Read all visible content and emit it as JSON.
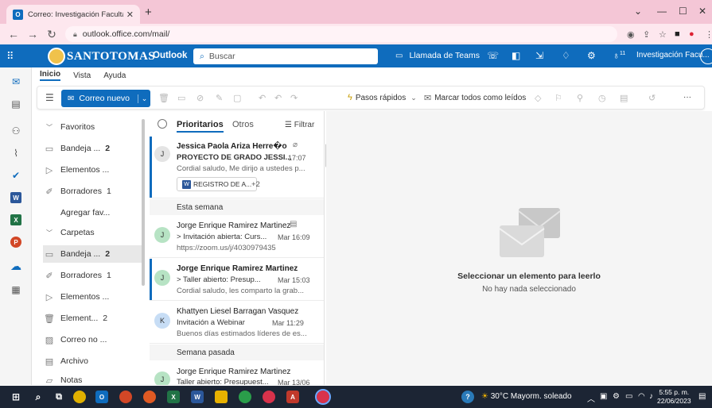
{
  "browser": {
    "tab_title": "Correo: Investigación Facultad de",
    "tab_close": "✕",
    "new_tab": "+",
    "url": "outlook.office.com/mail/",
    "win_min": "—",
    "win_max": "☐",
    "win_close": "✕",
    "win_menu": "⌄"
  },
  "suite": {
    "logo_text": "SANTOTOMAS",
    "app_name": "Outlook",
    "search_placeholder": "Buscar",
    "teams_call": "Llamada de Teams",
    "account": "Investigación Facu...",
    "badge": "11"
  },
  "ribbon_tabs": [
    "Inicio",
    "Vista",
    "Ayuda"
  ],
  "ribbon": {
    "new_mail": "Correo nuevo",
    "quick_steps": "Pasos rápidos",
    "mark_all_read": "Marcar todos como leídos",
    "more": "···"
  },
  "folders": {
    "favorites_label": "Favoritos",
    "fav_items": [
      {
        "label": "Bandeja ...",
        "count": "2"
      },
      {
        "label": "Elementos ...",
        "count": ""
      },
      {
        "label": "Borradores",
        "count": "1"
      }
    ],
    "add_favorite": "Agregar fav...",
    "folders_label": "Carpetas",
    "folder_items": [
      {
        "label": "Bandeja ...",
        "count": "2"
      },
      {
        "label": "Borradores",
        "count": "1"
      },
      {
        "label": "Elementos ...",
        "count": ""
      },
      {
        "label": "Element...",
        "count": "2"
      },
      {
        "label": "Correo no ...",
        "count": ""
      },
      {
        "label": "Archivo",
        "count": ""
      },
      {
        "label": "Notas",
        "count": ""
      }
    ]
  },
  "list": {
    "tab_focused": "Prioritarios",
    "tab_other": "Otros",
    "filter": "Filtrar",
    "group_week": "Esta semana",
    "group_last_week": "Semana pasada",
    "messages": [
      {
        "initial": "J",
        "from": "Jessica Paola Ariza Herre�o",
        "subject": "PROYECTO DE GRADO JESSI...",
        "time": "17:07",
        "preview": "Cordial saludo, Me dirijo a ustedes p...",
        "attachment": "REGISTRO DE A...",
        "extra": "+2"
      },
      {
        "initial": "J",
        "from": "Jorge Enrique Ramirez Martinez",
        "subject": "Invitación abierta: Curs...",
        "time": "Mar 16:09",
        "preview": "https://zoom.us/j/4030979435"
      },
      {
        "initial": "J",
        "from": "Jorge Enrique Ramirez Martinez",
        "subject": "Taller abierto: Presup...",
        "time": "Mar 15:03",
        "preview": "Cordial saludo, les comparto la grab..."
      },
      {
        "initial": "K",
        "from": "Khattyen Liesel Barragan Vasquez",
        "subject": "Invitación a Webinar",
        "time": "Mar 11:29",
        "preview": "Buenos días estimados líderes de es..."
      },
      {
        "initial": "J",
        "from": "Jorge Enrique Ramirez Martinez",
        "subject": "Taller abierto: Presupuest...",
        "time": "Mar 13/06",
        "preview": ""
      }
    ]
  },
  "reading": {
    "title": "Seleccionar un elemento para leerlo",
    "subtitle": "No hay nada seleccionado"
  },
  "taskbar": {
    "weather": "30°C  Mayorm. soleado",
    "time": "5:55 p. m.",
    "date": "22/06/2023"
  },
  "colors": {
    "brand": "#0f6cbd",
    "tabbar": "#f4c6d6",
    "taskbar": "#1c2534"
  }
}
